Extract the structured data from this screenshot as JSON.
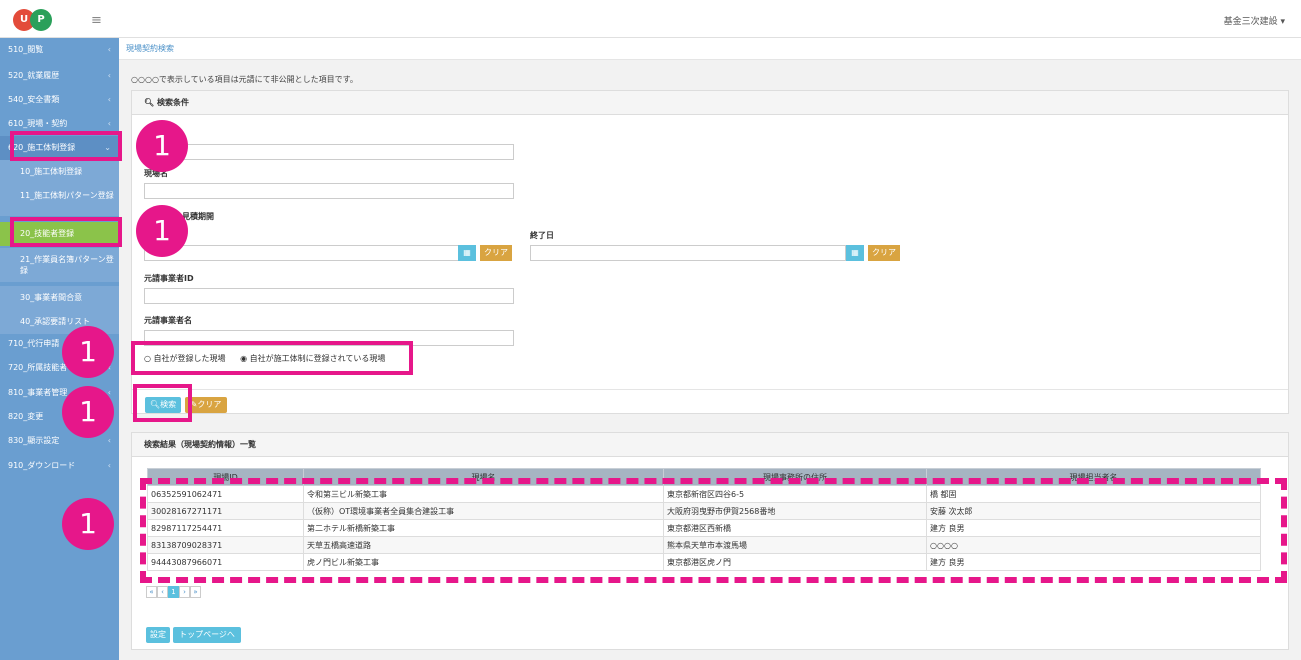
{
  "header": {
    "logo_text_1": "U",
    "logo_text_2": "P",
    "menu_icon": "hamburger-icon",
    "user": "基金三次建設 ▾"
  },
  "sidebar": {
    "items": [
      {
        "label": "510_閲覧"
      },
      {
        "label": "520_就業履歴"
      },
      {
        "label": "540_安全書類"
      },
      {
        "label": "610_現場・契約"
      },
      {
        "label": "620_施工体制登録"
      },
      {
        "label": "10_施工体制登録"
      },
      {
        "label": "11_施工体制パターン登録"
      },
      {
        "label": "20_技能者登録"
      },
      {
        "label": "21_作業員名簿パターン登録"
      },
      {
        "label": "30_事業者間合意"
      },
      {
        "label": "40_承認要請リスト"
      },
      {
        "label": "710_代行申請"
      },
      {
        "label": "720_所属技能者"
      },
      {
        "label": "810_事業者管理"
      },
      {
        "label": "820_変更"
      },
      {
        "label": "830_顯示設定"
      },
      {
        "label": "910_ダウンロード"
      }
    ]
  },
  "breadcrumb": "現場契約検索",
  "notice": "○○○○で表示している項目は元請にて非公開とした項目です。",
  "search": {
    "title": "検索条件",
    "field_site_id_label": "",
    "field_site_name_label": "現場名",
    "field_period_label": "見積期開",
    "field_end_label": "終了日",
    "field_contractor_id_label": "元請事業者ID",
    "field_contractor_name_label": "元請事業者名",
    "clear_label": "クリア",
    "radio_1": "○ 自社が登録した現場",
    "radio_2": "◉ 自社が施工体制に登録されている現場",
    "search_button": "検索",
    "clear_button": "クリア"
  },
  "results": {
    "title": "検索結果（現場契約情報）一覧",
    "columns": [
      "現場ID",
      "現場名",
      "現場事務所の住所",
      "現場担当者名"
    ],
    "rows": [
      [
        "06352591062471",
        "令和第三ビル新築工事",
        "東京都新宿区四谷6-5",
        "橋 都固"
      ],
      [
        "30028167271171",
        "（仮称）OT環境事業者全員集合建設工事",
        "大阪府羽曳野市伊賀2568番地",
        "安藤 次太郎"
      ],
      [
        "82987117254471",
        "第二ホテル新橋新築工事",
        "東京都港区西新橋",
        "建方 良男"
      ],
      [
        "83138709028371",
        "天草五橋高速道路",
        "熊本県天草市本渡馬場",
        "○○○○"
      ],
      [
        "94443087966071",
        "虎ノ門ビル新築工事",
        "東京都港区虎ノ門",
        "建方 良男"
      ]
    ],
    "pager": [
      "«",
      "‹",
      "1",
      "›",
      "»"
    ]
  },
  "footer": {
    "settings_button": "設定",
    "top_button": "トップページへ"
  },
  "annotations": {
    "badge_label": "1",
    "accent": "#e6178a"
  }
}
